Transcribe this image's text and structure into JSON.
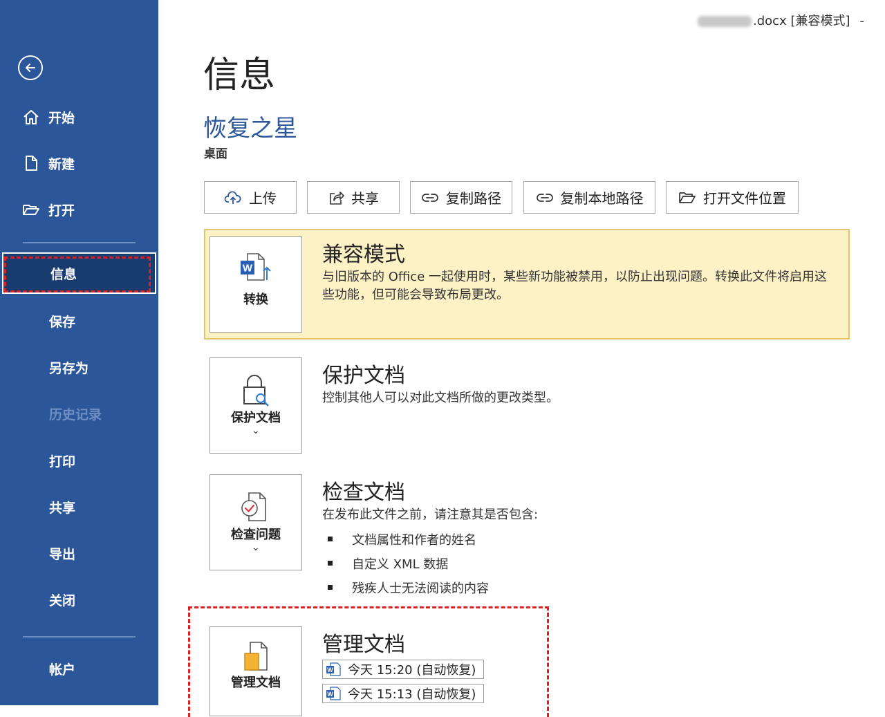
{
  "window": {
    "title_suffix": ".docx [兼容模式]",
    "dash": "-"
  },
  "sidebar": {
    "items": [
      {
        "label": "开始",
        "icon": "home-icon"
      },
      {
        "label": "新建",
        "icon": "new-document-icon"
      },
      {
        "label": "打开",
        "icon": "folder-open-icon"
      },
      {
        "label": "信息"
      },
      {
        "label": "保存"
      },
      {
        "label": "另存为"
      },
      {
        "label": "历史记录",
        "disabled": true
      },
      {
        "label": "打印"
      },
      {
        "label": "共享"
      },
      {
        "label": "导出"
      },
      {
        "label": "关闭"
      },
      {
        "label": "帐户"
      }
    ]
  },
  "main": {
    "page_title": "信息",
    "doc_name": "恢复之星",
    "doc_location": "桌面",
    "toolbar": {
      "upload": "上传",
      "share": "共享",
      "copy_path": "复制路径",
      "copy_local_path": "复制本地路径",
      "open_location": "打开文件位置"
    },
    "compat": {
      "tile_label": "转换",
      "title": "兼容模式",
      "desc": "与旧版本的 Office 一起使用时，某些新功能被禁用，以防止出现问题。转换此文件将启用这些功能，但可能会导致布局更改。"
    },
    "protect": {
      "tile_label": "保护文档",
      "chevron": "⌄",
      "title": "保护文档",
      "desc": "控制其他人可以对此文档所做的更改类型。"
    },
    "inspect": {
      "tile_label": "检查问题",
      "chevron": "⌄",
      "title": "检查文档",
      "desc": "在发布此文件之前，请注意其是否包含:",
      "bullets": [
        "文档属性和作者的姓名",
        "自定义 XML 数据",
        "残疾人士无法阅读的内容"
      ]
    },
    "manage": {
      "tile_label": "管理文档",
      "chevron": "⌄",
      "title": "管理文档",
      "versions": [
        "今天 15:20 (自动恢复)",
        "今天 15:13 (自动恢复)"
      ]
    }
  },
  "colors": {
    "sidebar_bg": "#2b579a",
    "active_bg": "#183b70",
    "accent": "#2b579a",
    "compat_bg": "#fdf1c6",
    "highlight": "#e02020"
  }
}
